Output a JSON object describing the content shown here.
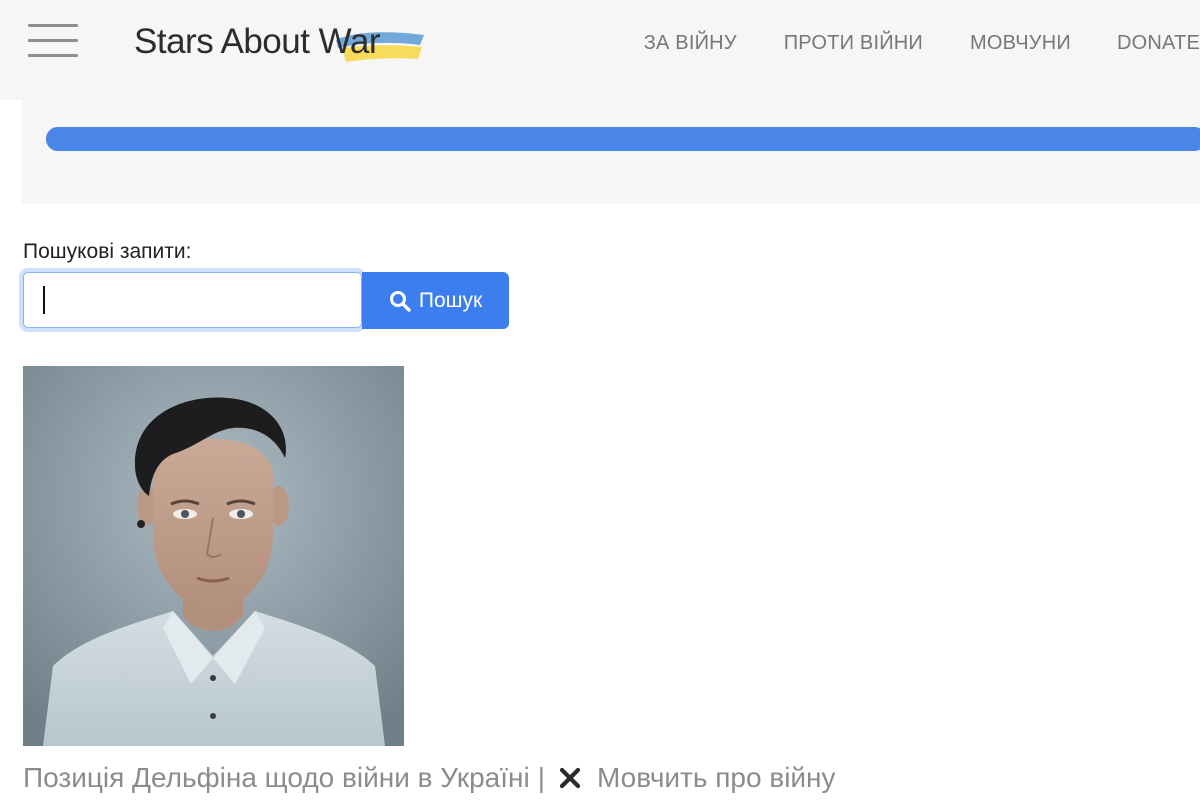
{
  "header": {
    "logo_text": "Stars About War",
    "nav": [
      {
        "label": "ЗА ВІЙНУ"
      },
      {
        "label": "ПРОТИ ВІЙНИ"
      },
      {
        "label": "МОВЧУНИ"
      },
      {
        "label": "DONATE"
      }
    ]
  },
  "progress": {
    "value_percent": 100,
    "color": "#4a86e8"
  },
  "search": {
    "label": "Пошукові запити:",
    "value": "",
    "button_label": "Пошук"
  },
  "card": {
    "title": "Позиція Дельфіна щодо війни в Україні",
    "separator": "|",
    "status_icon": "x-mark-icon",
    "status_text": "Мовчить про війну"
  },
  "colors": {
    "accent": "#3d7eee",
    "header_bg": "#f6f6f6",
    "muted_text": "#8c8c8c"
  }
}
